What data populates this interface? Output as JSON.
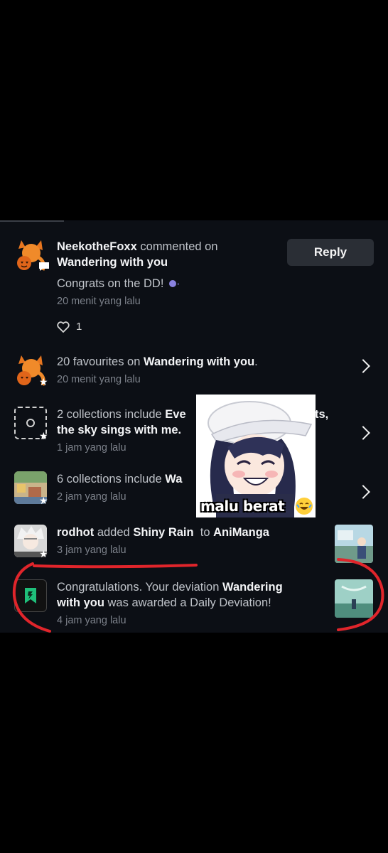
{
  "notifications": [
    {
      "user": "NeekotheFoxx",
      "action": "commented on",
      "target": "Wandering with you",
      "comment": "Congrats on the DD!",
      "time": "20 menit yang lalu",
      "likes": "1",
      "reply_label": "Reply"
    },
    {
      "count_text": "20 favourites on",
      "target": "Wandering with you",
      "suffix": ".",
      "time": "20 menit yang lalu"
    },
    {
      "count_text": "2 collections include",
      "title_visible_1": "Eve",
      "title_visible_2": "ts,",
      "line2": "the sky sings with me.",
      "time": "1 jam yang lalu"
    },
    {
      "count_text": "6 collections include",
      "title_visible": "Wa",
      "time": "2 jam yang lalu"
    },
    {
      "user": "rodhot",
      "action": "added",
      "title": "Shiny Rain",
      "to": "to",
      "collection": "AniManga",
      "time": "3 jam yang lalu"
    },
    {
      "text_1": "Congratulations. Your deviation",
      "title_1": "Wandering",
      "title_2": "with you",
      "text_2": "was awarded a Daily Deviation!",
      "time": "4 jam yang lalu"
    }
  ],
  "overlay": {
    "caption": "malu berat"
  },
  "colors": {
    "panel": "#0c0f15",
    "annotation": "#e0252b",
    "fox_orange": "#e8761f"
  }
}
